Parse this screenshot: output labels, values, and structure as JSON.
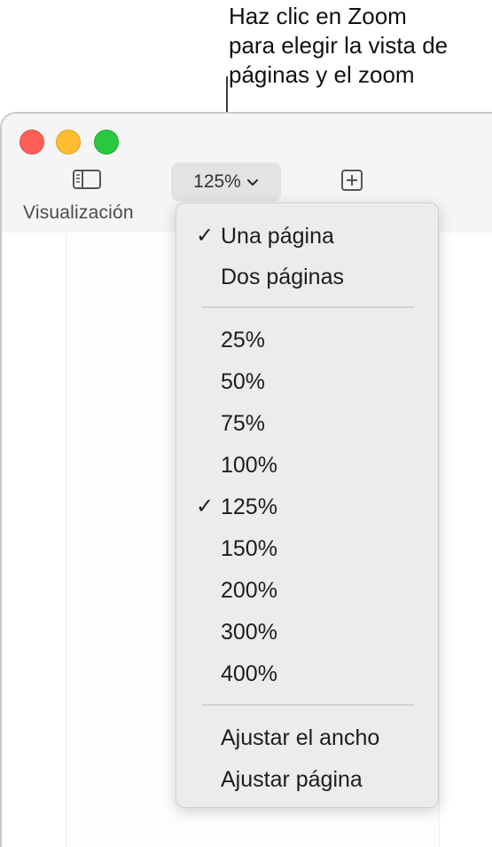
{
  "callout": {
    "line1": "Haz clic en Zoom",
    "line2": "para elegir la vista de",
    "line3": "páginas y el zoom"
  },
  "toolbar": {
    "view_label": "Visualización",
    "zoom_value": "125%"
  },
  "menu": {
    "page_items": [
      {
        "label": "Una página",
        "checked": true
      },
      {
        "label": "Dos páginas",
        "checked": false
      }
    ],
    "zoom_items": [
      {
        "label": "25%",
        "checked": false
      },
      {
        "label": "50%",
        "checked": false
      },
      {
        "label": "75%",
        "checked": false
      },
      {
        "label": "100%",
        "checked": false
      },
      {
        "label": "125%",
        "checked": true
      },
      {
        "label": "150%",
        "checked": false
      },
      {
        "label": "200%",
        "checked": false
      },
      {
        "label": "300%",
        "checked": false
      },
      {
        "label": "400%",
        "checked": false
      }
    ],
    "fit_items": [
      {
        "label": "Ajustar el ancho",
        "checked": false
      },
      {
        "label": "Ajustar página",
        "checked": false
      }
    ],
    "check_glyph": "✓"
  },
  "colors": {
    "close": "#ff5f57",
    "minimize": "#febc2e",
    "maximize": "#28c840",
    "menu_bg": "#ececec"
  }
}
